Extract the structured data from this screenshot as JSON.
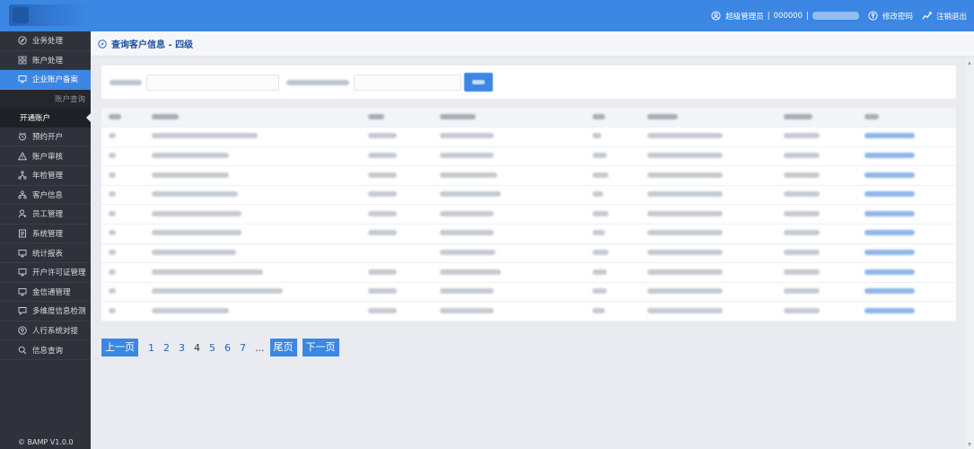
{
  "header": {
    "role_label": "超级管理员",
    "account_code": "000000",
    "change_password_label": "修改密码",
    "logout_label": "注销退出"
  },
  "sidebar": {
    "items": [
      {
        "label": "业务处理",
        "icon": "compass-icon"
      },
      {
        "label": "账户处理",
        "icon": "grid-icon"
      },
      {
        "label": "企业账户备案",
        "icon": "monitor-icon",
        "active": true
      },
      {
        "label": "预约开户",
        "icon": "alarm-clock-icon"
      },
      {
        "label": "账户审核",
        "icon": "warning-icon"
      },
      {
        "label": "年检管理",
        "icon": "branch-icon"
      },
      {
        "label": "客户信息",
        "icon": "org-chart-icon"
      },
      {
        "label": "员工管理",
        "icon": "user-icon"
      },
      {
        "label": "系统管理",
        "icon": "document-icon"
      },
      {
        "label": "统计报表",
        "icon": "monitor-icon"
      },
      {
        "label": "开户许可证管理",
        "icon": "monitor-icon"
      },
      {
        "label": "金信通管理",
        "icon": "monitor-icon"
      },
      {
        "label": "多维度信息检测",
        "icon": "chat-icon"
      },
      {
        "label": "人行系统对接",
        "icon": "circle-icon"
      },
      {
        "label": "信息查询",
        "icon": "search-icon"
      }
    ],
    "sub_items": [
      {
        "label": "账户查询"
      },
      {
        "label": "开通账户",
        "selected": true
      }
    ],
    "version": "© BAMP V1.0.0"
  },
  "page": {
    "title": "查询客户信息 - 四级"
  },
  "pagination": {
    "prev_label": "上一页",
    "pages": [
      "1",
      "2",
      "3",
      "4",
      "5",
      "6",
      "7"
    ],
    "current_page": "4",
    "ellipsis": "...",
    "last_label": "尾页",
    "next_label": "下一页"
  },
  "colors": {
    "topbar": "#3b87e3",
    "sidebar": "#2f323a",
    "accent": "#3b87e3",
    "title": "#1f4fa0"
  }
}
